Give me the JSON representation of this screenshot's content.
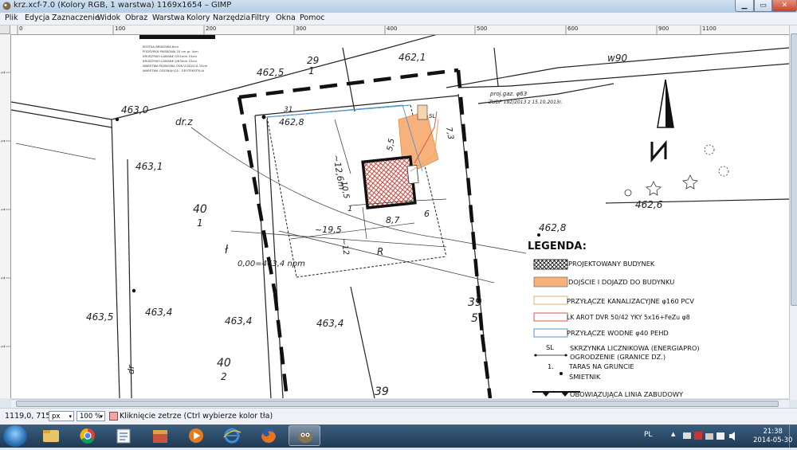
{
  "window": {
    "title": "krz.xcf-7.0 (Kolory RGB, 1 warstwa) 1169x1654 – GIMP",
    "min_glyph": "▁",
    "max_glyph": "▭",
    "close_glyph": "✕"
  },
  "menu": [
    "Plik",
    "Edycja",
    "Zaznaczenie",
    "Widok",
    "Obraz",
    "Warstwa",
    "Kolory",
    "Narzędzia",
    "Filtry",
    "Okna",
    "Pomoc"
  ],
  "ruler": {
    "top_labels": [
      "0",
      "100",
      "200",
      "300",
      "400",
      "500",
      "600",
      "700",
      "800",
      "900",
      "1000",
      "1100"
    ],
    "left_labels": [
      "1000",
      "1100",
      "1200",
      "1300",
      "1400",
      "1500"
    ]
  },
  "map": {
    "labels": {
      "l1": "462,5",
      "l2": "29",
      "l3": "1",
      "l4": "462,1",
      "l5": "w90",
      "l6": "463,0",
      "l7": "dr.z",
      "l8": "463,1",
      "l9": "40",
      "l10": "1",
      "l11": "ł",
      "l12": "462,8",
      "l13": "463,5",
      "l14": "463,4",
      "l15": "463,4",
      "l16": "463,4",
      "l17": "40",
      "l18": "2",
      "l19": "39",
      "l20": "5",
      "l21": "39",
      "l22": "462,6",
      "l23": "462,8",
      "l24": "~12,6m",
      "l25": "5,5",
      "l26": "7,3",
      "l27": "8,7",
      "l28": "6",
      "l29": "~19,5",
      "l30": "~12",
      "l31": "R",
      "l32": "0,00=463,4 npm",
      "l33": "proj.gaz. φ63",
      "l34": "ZUDP 192/2013 z 15.10.2013r.",
      "l35": "10,5",
      "l36": "462,8",
      "l37": "1",
      "l38": "SL",
      "l39": "dr",
      "l40": "31"
    },
    "table_lines": [
      "KOSTKA BRUKOWA 8cm",
      "PODSYPKA PIASKOWA 20 cm gr. 4cm",
      "KRUSZYWO ŁAMANE 0/31mm 15cm",
      "KRUSZYWO ŁAMANE 0/63mm 15cm",
      "WARSTWA PIASKOWA ODSĄCZAJĄCA 15cm",
      "WARSTWA ODCINAJĄCA - GEOTEKSTYLIA"
    ]
  },
  "legend": {
    "title": "LEGENDA:",
    "items": [
      "PROJEKTOWANY BUDYNEK",
      "DOJŚCIE I DOJAZD DO BUDYNKU",
      "PRZYŁĄCZE KANALIZACYJNE  φ160 PCV",
      "LK  AROT DVR 50/42 YKY 5x16+FeZu φ8",
      "PRZYŁĄCZE WODNE  φ40 PEHD",
      "SKRZYNKA LICZNIKOWA  (ENERGIAPRO)",
      "OGRODZENIE (GRANICE DZ.)",
      "TARAS NA GRUNCIE",
      "ŚMIETNIK",
      "OBOWIĄZUJĄCA LINIA ZABUDOWY"
    ],
    "sl_label": "SL",
    "num_label": "1."
  },
  "status": {
    "coords": "1119,0, 715,0",
    "unit": "px",
    "zoom": "100 %",
    "message": "Kliknięcie zetrze (Ctrl wybierze kolor tła)"
  },
  "taskbar": {
    "lang": "PL",
    "time": "21:38",
    "date": "2014-05-30"
  },
  "colors": {
    "building_hatch": "#c0392b",
    "path_fill": "#f7b27b",
    "sewer": "#d8b56a",
    "cable": "#d9534f",
    "water": "#5b8fd0"
  }
}
